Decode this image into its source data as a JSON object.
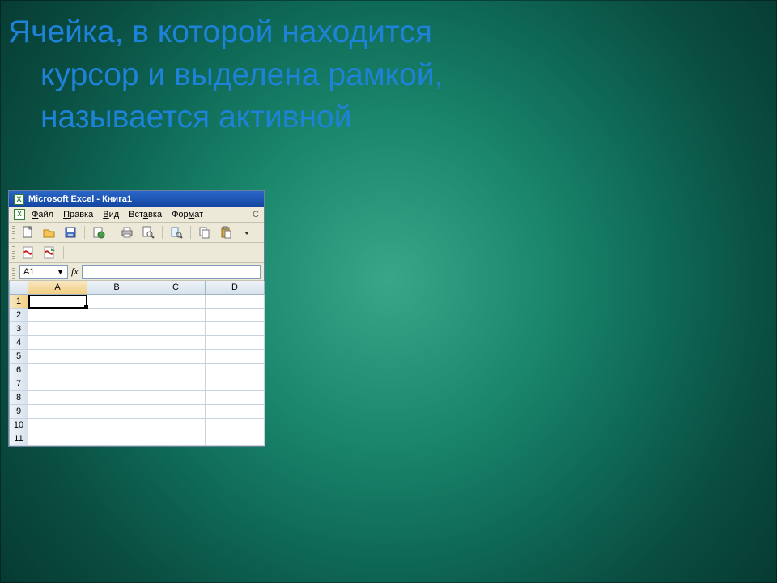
{
  "title": {
    "line1": "Ячейка, в которой находится",
    "line2": "курсор и выделена рамкой,",
    "line3": "называется активной"
  },
  "excel": {
    "window_title": "Microsoft Excel - Книга1",
    "excel_logo_glyph": "X",
    "menu": {
      "file": "Файл",
      "edit": "Правка",
      "view": "Вид",
      "insert": "Вставка",
      "format": "Формат",
      "overflow": "С"
    },
    "namebox_value": "A1",
    "fx_label": "fx",
    "columns": [
      "A",
      "B",
      "C",
      "D"
    ],
    "rows": [
      "1",
      "2",
      "3",
      "4",
      "5",
      "6",
      "7",
      "8",
      "9",
      "10",
      "11"
    ],
    "active_cell": {
      "row": 1,
      "col": "A"
    }
  },
  "icons": {
    "new": "new",
    "open": "open",
    "save": "save",
    "permission": "permission",
    "print": "print",
    "printpreview": "printpreview",
    "research": "research",
    "copy": "copy",
    "paste": "paste",
    "pdf": "pdf",
    "pdf2": "pdf2"
  }
}
